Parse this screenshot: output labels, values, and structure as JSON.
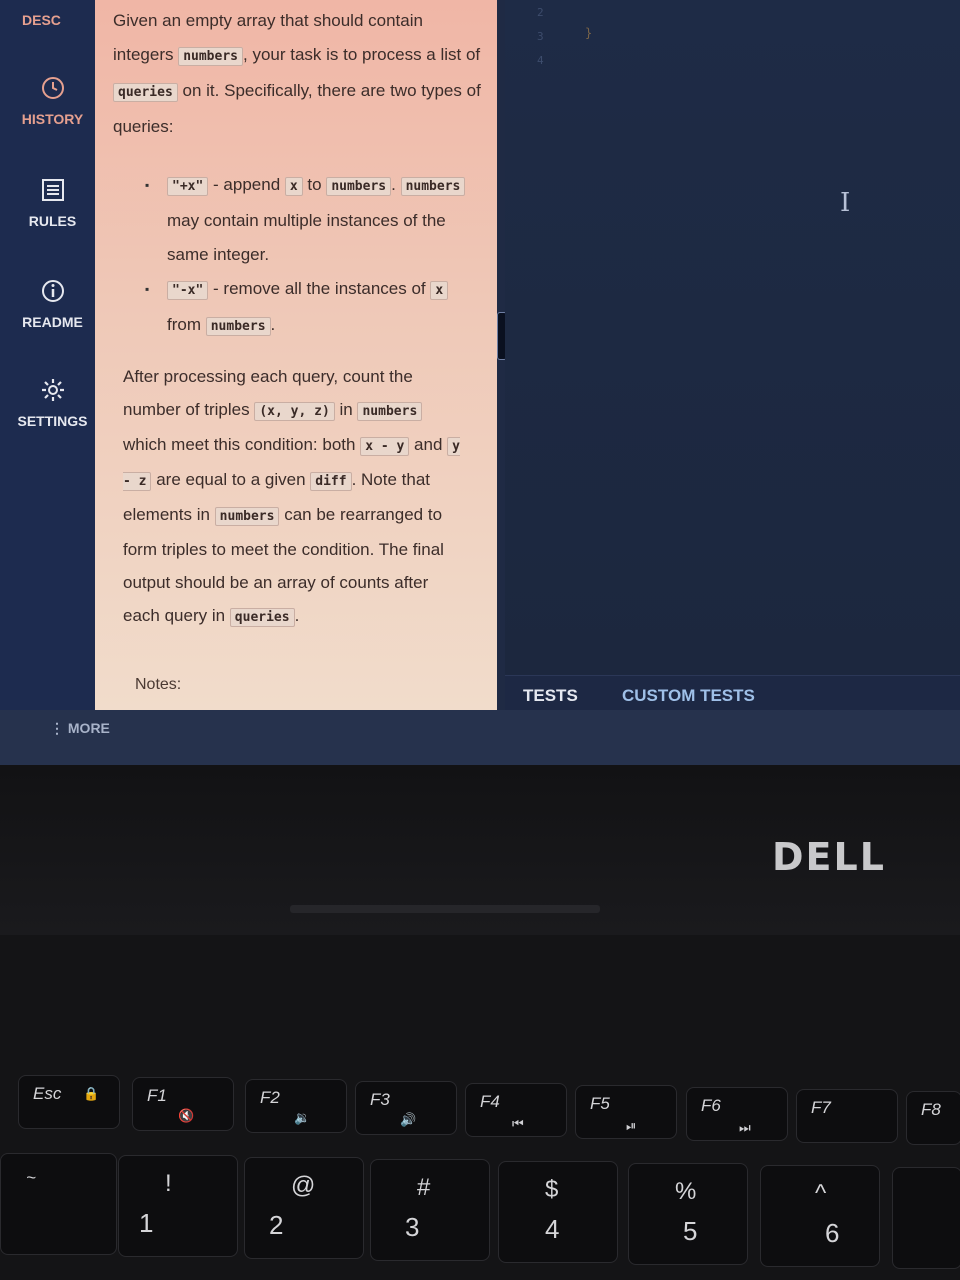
{
  "sidebar": {
    "desc": "DESC",
    "history": "HISTORY",
    "rules": "RULES",
    "readme": "README",
    "settings": "SETTINGS"
  },
  "description": {
    "p1": [
      "Given an empty array that should contain integers ",
      "numbers",
      ", your task is to process a list of ",
      "queries",
      " on it. Specifically, there are two types of queries:"
    ],
    "bullet1": [
      "\"+x\"",
      " - append ",
      "x",
      " to ",
      "numbers",
      ". ",
      "numbers",
      " may contain multiple instances of the same integer."
    ],
    "bullet2": [
      "\"-x\"",
      " - remove all the instances of ",
      "x",
      " from ",
      "numbers",
      "."
    ],
    "p2": [
      "After processing each query, count the number of triples ",
      "(x, y, z)",
      " in ",
      "numbers",
      " which meet this condition: both ",
      "x - y",
      " and ",
      "y - z",
      " are equal to a given ",
      "diff",
      ". Note that elements in ",
      "numbers",
      " can be rearranged to form triples to meet the condition. The final output should be an array of counts after each query in ",
      "queries",
      "."
    ],
    "notes": "Notes:"
  },
  "editor": {
    "line_numbers": [
      "2",
      "3",
      "4"
    ],
    "brace": "}"
  },
  "tabs": {
    "tests": "TESTS",
    "custom_tests": "CUSTOM TESTS"
  },
  "more": "⋮ MORE",
  "brand": "DELL",
  "keys": {
    "esc": "Esc",
    "f1": "F1",
    "f2": "F2",
    "f3": "F3",
    "f4": "F4",
    "f5": "F5",
    "f6": "F6",
    "f7": "F7",
    "f8": "F8",
    "row": [
      {
        "top": "!",
        "bot": "1"
      },
      {
        "top": "@",
        "bot": "2"
      },
      {
        "top": "#",
        "bot": "3"
      },
      {
        "top": "$",
        "bot": "4"
      },
      {
        "top": "%",
        "bot": "5"
      },
      {
        "top": "^",
        "bot": "6"
      }
    ]
  }
}
